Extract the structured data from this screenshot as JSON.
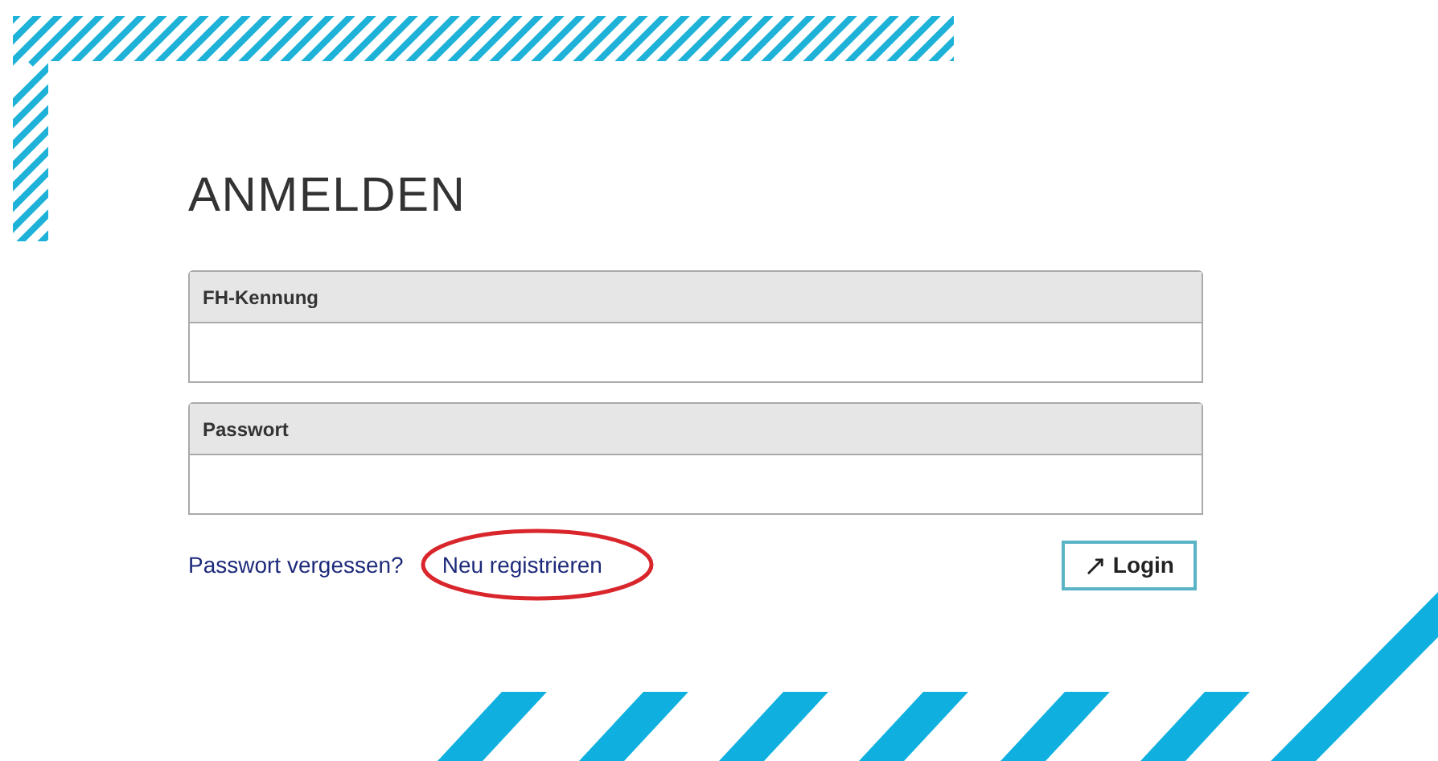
{
  "title": "ANMELDEN",
  "fields": [
    {
      "label": "FH-Kennung"
    },
    {
      "label": "Passwort"
    }
  ],
  "links": [
    {
      "label": "Passwort vergessen?",
      "circled": false
    },
    {
      "label": "Neu registrieren",
      "circled": true
    }
  ],
  "login_button": {
    "label": "Login"
  }
}
